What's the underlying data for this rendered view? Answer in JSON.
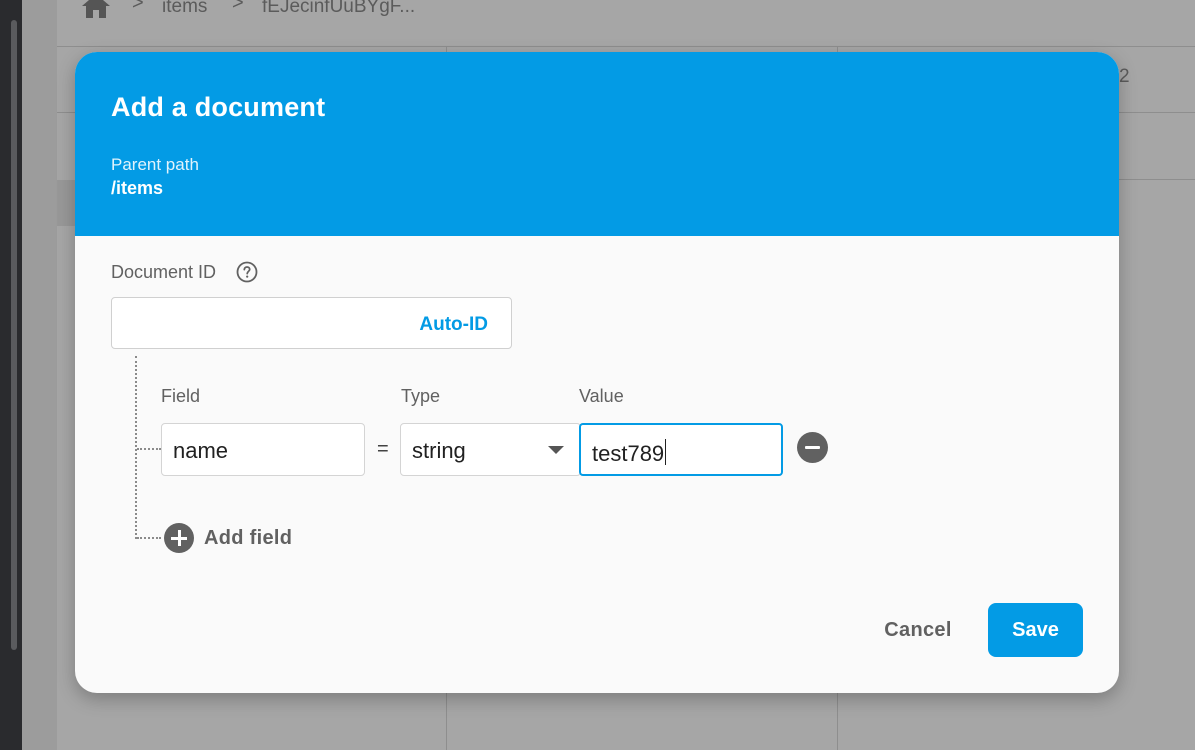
{
  "breadcrumb": {
    "home_icon": "home-icon",
    "items": [
      "items",
      "fEJecinfUuBYgF..."
    ],
    "separator": ">"
  },
  "background": {
    "partial_text": "2"
  },
  "dialog": {
    "title": "Add a document",
    "parent_path_label": "Parent path",
    "parent_path_value": "/items",
    "header_color": "#039be5",
    "document_id": {
      "label": "Document ID",
      "help_icon": "help-circle-icon",
      "value": "",
      "auto_id_label": "Auto-ID"
    },
    "columns": {
      "field": "Field",
      "type": "Type",
      "value": "Value"
    },
    "fields": [
      {
        "name": "name",
        "equals": "=",
        "type": "string",
        "value": "test789"
      }
    ],
    "add_field_label": "Add field",
    "cancel_label": "Cancel",
    "save_label": "Save",
    "accent_color": "#039be5"
  }
}
